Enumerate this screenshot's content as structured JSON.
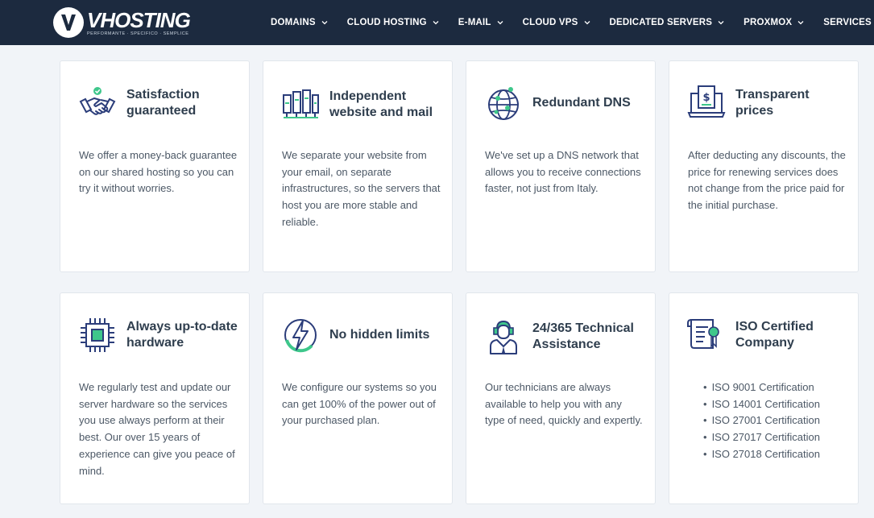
{
  "brand": {
    "name": "VHOSTING",
    "tagline": "PERFORMANTE · SPECIFICO · SEMPLICE"
  },
  "nav": {
    "items": [
      {
        "label": "DOMAINS"
      },
      {
        "label": "CLOUD HOSTING"
      },
      {
        "label": "E-MAIL"
      },
      {
        "label": "CLOUD VPS"
      },
      {
        "label": "DEDICATED SERVERS"
      },
      {
        "label": "PROXMOX"
      },
      {
        "label": "SERVICES"
      }
    ]
  },
  "features": [
    {
      "icon": "handshake-icon",
      "title": "Satisfaction guaranteed",
      "text": "We offer a money-back guarantee on our shared hosting so you can try it without worries."
    },
    {
      "icon": "server-rack-icon",
      "title": "Independent website and mail",
      "text": "We separate your website from your email, on separate infrastructures, so the servers that host you are more stable and reliable."
    },
    {
      "icon": "globe-network-icon",
      "title": "Redundant DNS",
      "text": "We've set up a DNS network that allows you to receive connections faster, not just from Italy."
    },
    {
      "icon": "price-laptop-icon",
      "title": "Transparent prices",
      "text": "After deducting any discounts, the price for renewing services does not change from the price paid for the initial purchase."
    },
    {
      "icon": "cpu-chip-icon",
      "title": "Always up-to-date hardware",
      "text": "We regularly test and update our server hardware so the services you use always perform at their best. Our over 15 years of experience can give you peace of mind."
    },
    {
      "icon": "lightning-icon",
      "title": "No hidden limits",
      "text": "We configure our systems so you can get 100% of the power out of your purchased plan."
    },
    {
      "icon": "support-agent-icon",
      "title": "24/365 Technical Assistance",
      "text": "Our technicians are always available to help you with any type of need, quickly and expertly."
    },
    {
      "icon": "certificate-icon",
      "title": "ISO Certified Company",
      "certifications": [
        "ISO 9001 Certification",
        "ISO 14001 Certification",
        "ISO 27001 Certification",
        "ISO 27017 Certification",
        "ISO 27018 Certification"
      ]
    }
  ],
  "colors": {
    "navbar": "#1c2a3f",
    "accent_green": "#3ec78b",
    "icon_navy": "#2b3d7a",
    "background": "#f1f4f8"
  }
}
